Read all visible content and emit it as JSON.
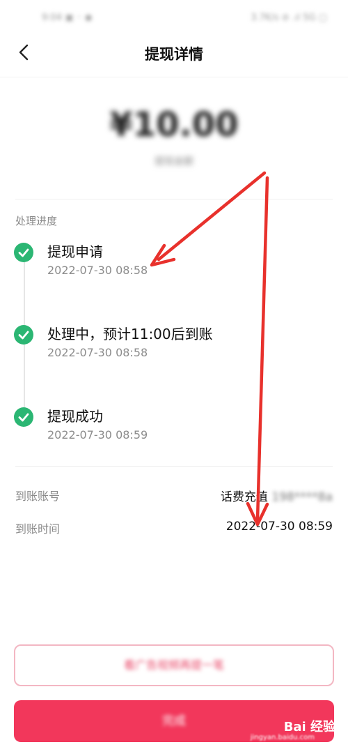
{
  "status_bar": {
    "left_text": "9:04 ▣ ◦ ◉",
    "right_text": "3.7K/s ⊘ .ıl 5G ▢"
  },
  "nav": {
    "title": "提现详情",
    "back_icon": "chevron-left-icon"
  },
  "amount": {
    "value": "¥10.00",
    "subtitle": "提现金额"
  },
  "progress": {
    "label": "处理进度",
    "check_icon": "check-circle-icon",
    "accent_color": "#2bb673",
    "steps": [
      {
        "title": "提现申请",
        "time": "2022-07-30 08:58"
      },
      {
        "title": "处理中，预计11:00后到账",
        "time": "2022-07-30 08:58"
      },
      {
        "title": "提现成功",
        "time": "2022-07-30 08:59"
      }
    ]
  },
  "details": {
    "account": {
      "label": "到账账号",
      "value": "话费充值",
      "value_masked": "198****8a"
    },
    "time": {
      "label": "到账时间",
      "value": "2022-07-30 08:59"
    }
  },
  "buttons": {
    "secondary_label": "看广告视频再提一笔",
    "primary_label": "完成",
    "primary_color": "#f2375b"
  },
  "watermark": {
    "text": "Bai 经验",
    "sub": "jingyan.baidu.com"
  },
  "annotation": {
    "color": "#e8312c"
  }
}
